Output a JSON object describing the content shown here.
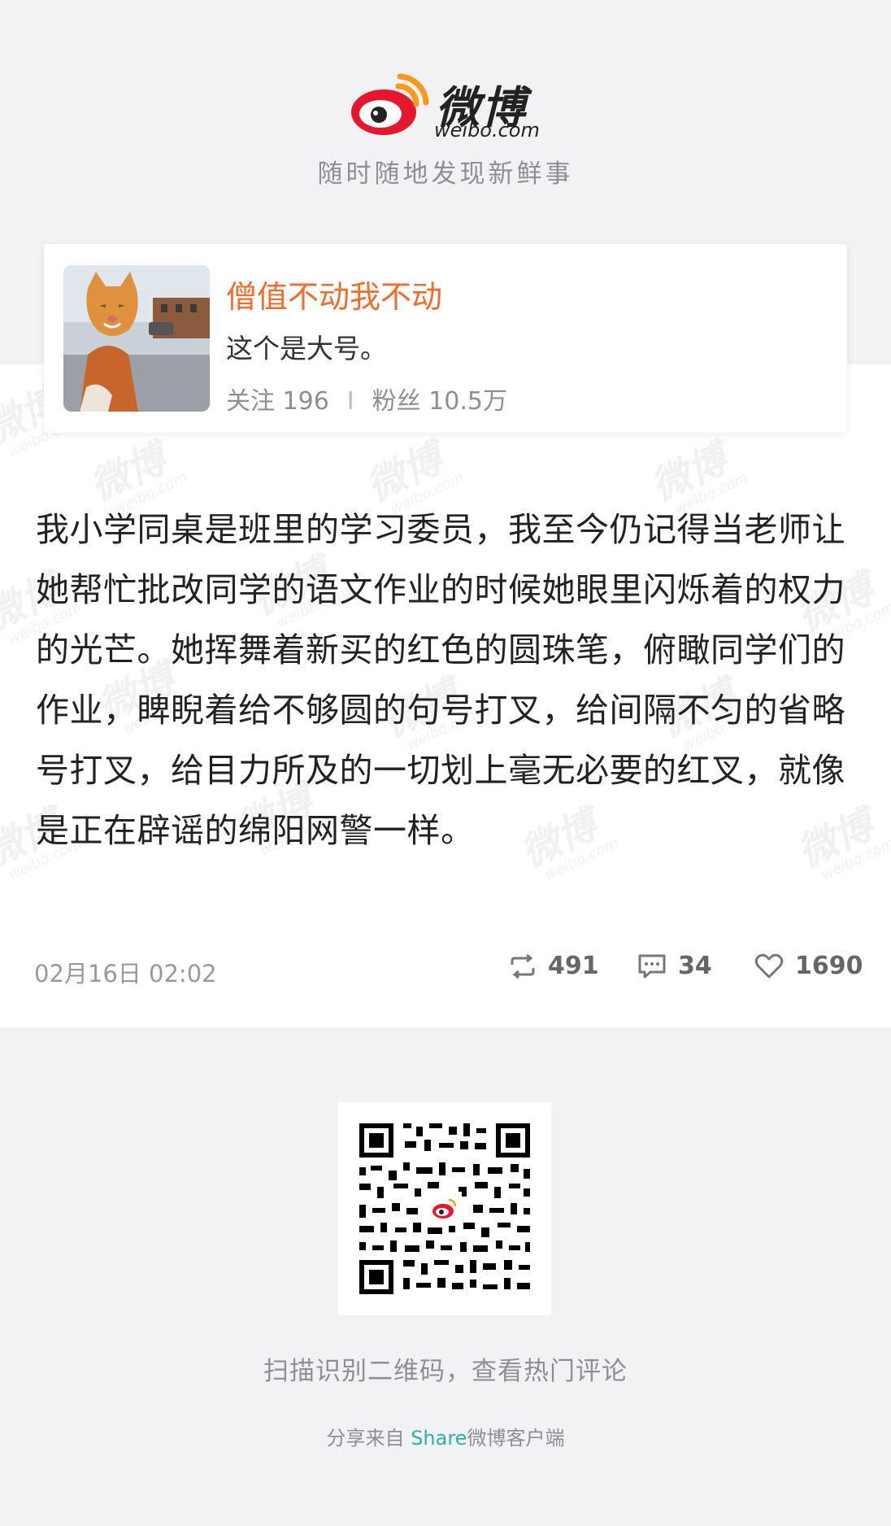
{
  "header": {
    "logo_cn": "微博",
    "logo_en": "weibo.com",
    "slogan": "随时随地发现新鲜事"
  },
  "user": {
    "name": "僧值不动我不动",
    "bio": "这个是大号。",
    "following_label": "关注 196",
    "separator": "I",
    "followers_label": "粉丝 10.5万"
  },
  "post": {
    "text": "我小学同桌是班里的学习委员，我至今仍记得当老师让她帮忙批改同学的语文作业的时候她眼里闪烁着的权力的光芒。她挥舞着新买的红色的圆珠笔，俯瞰同学们的作业，睥睨着给不够圆的句号打叉，给间隔不匀的省略号打叉，给目力所及的一切划上毫无必要的红叉，就像是正在辟谣的绵阳网警一样。",
    "time": "02月16日 02:02",
    "reposts": "491",
    "comments": "34",
    "likes": "1690"
  },
  "watermark": {
    "text": "微博",
    "sub": "weibo.com"
  },
  "footer": {
    "qr_caption": "扫描识别二维码，查看热门评论",
    "share_prefix": "分享来自 ",
    "share_accent": "Share",
    "share_suffix": "微博客户端"
  },
  "colors": {
    "accent_orange": "#f26c2b",
    "accent_teal": "#2fb0a6",
    "weibo_red": "#e6162d"
  }
}
